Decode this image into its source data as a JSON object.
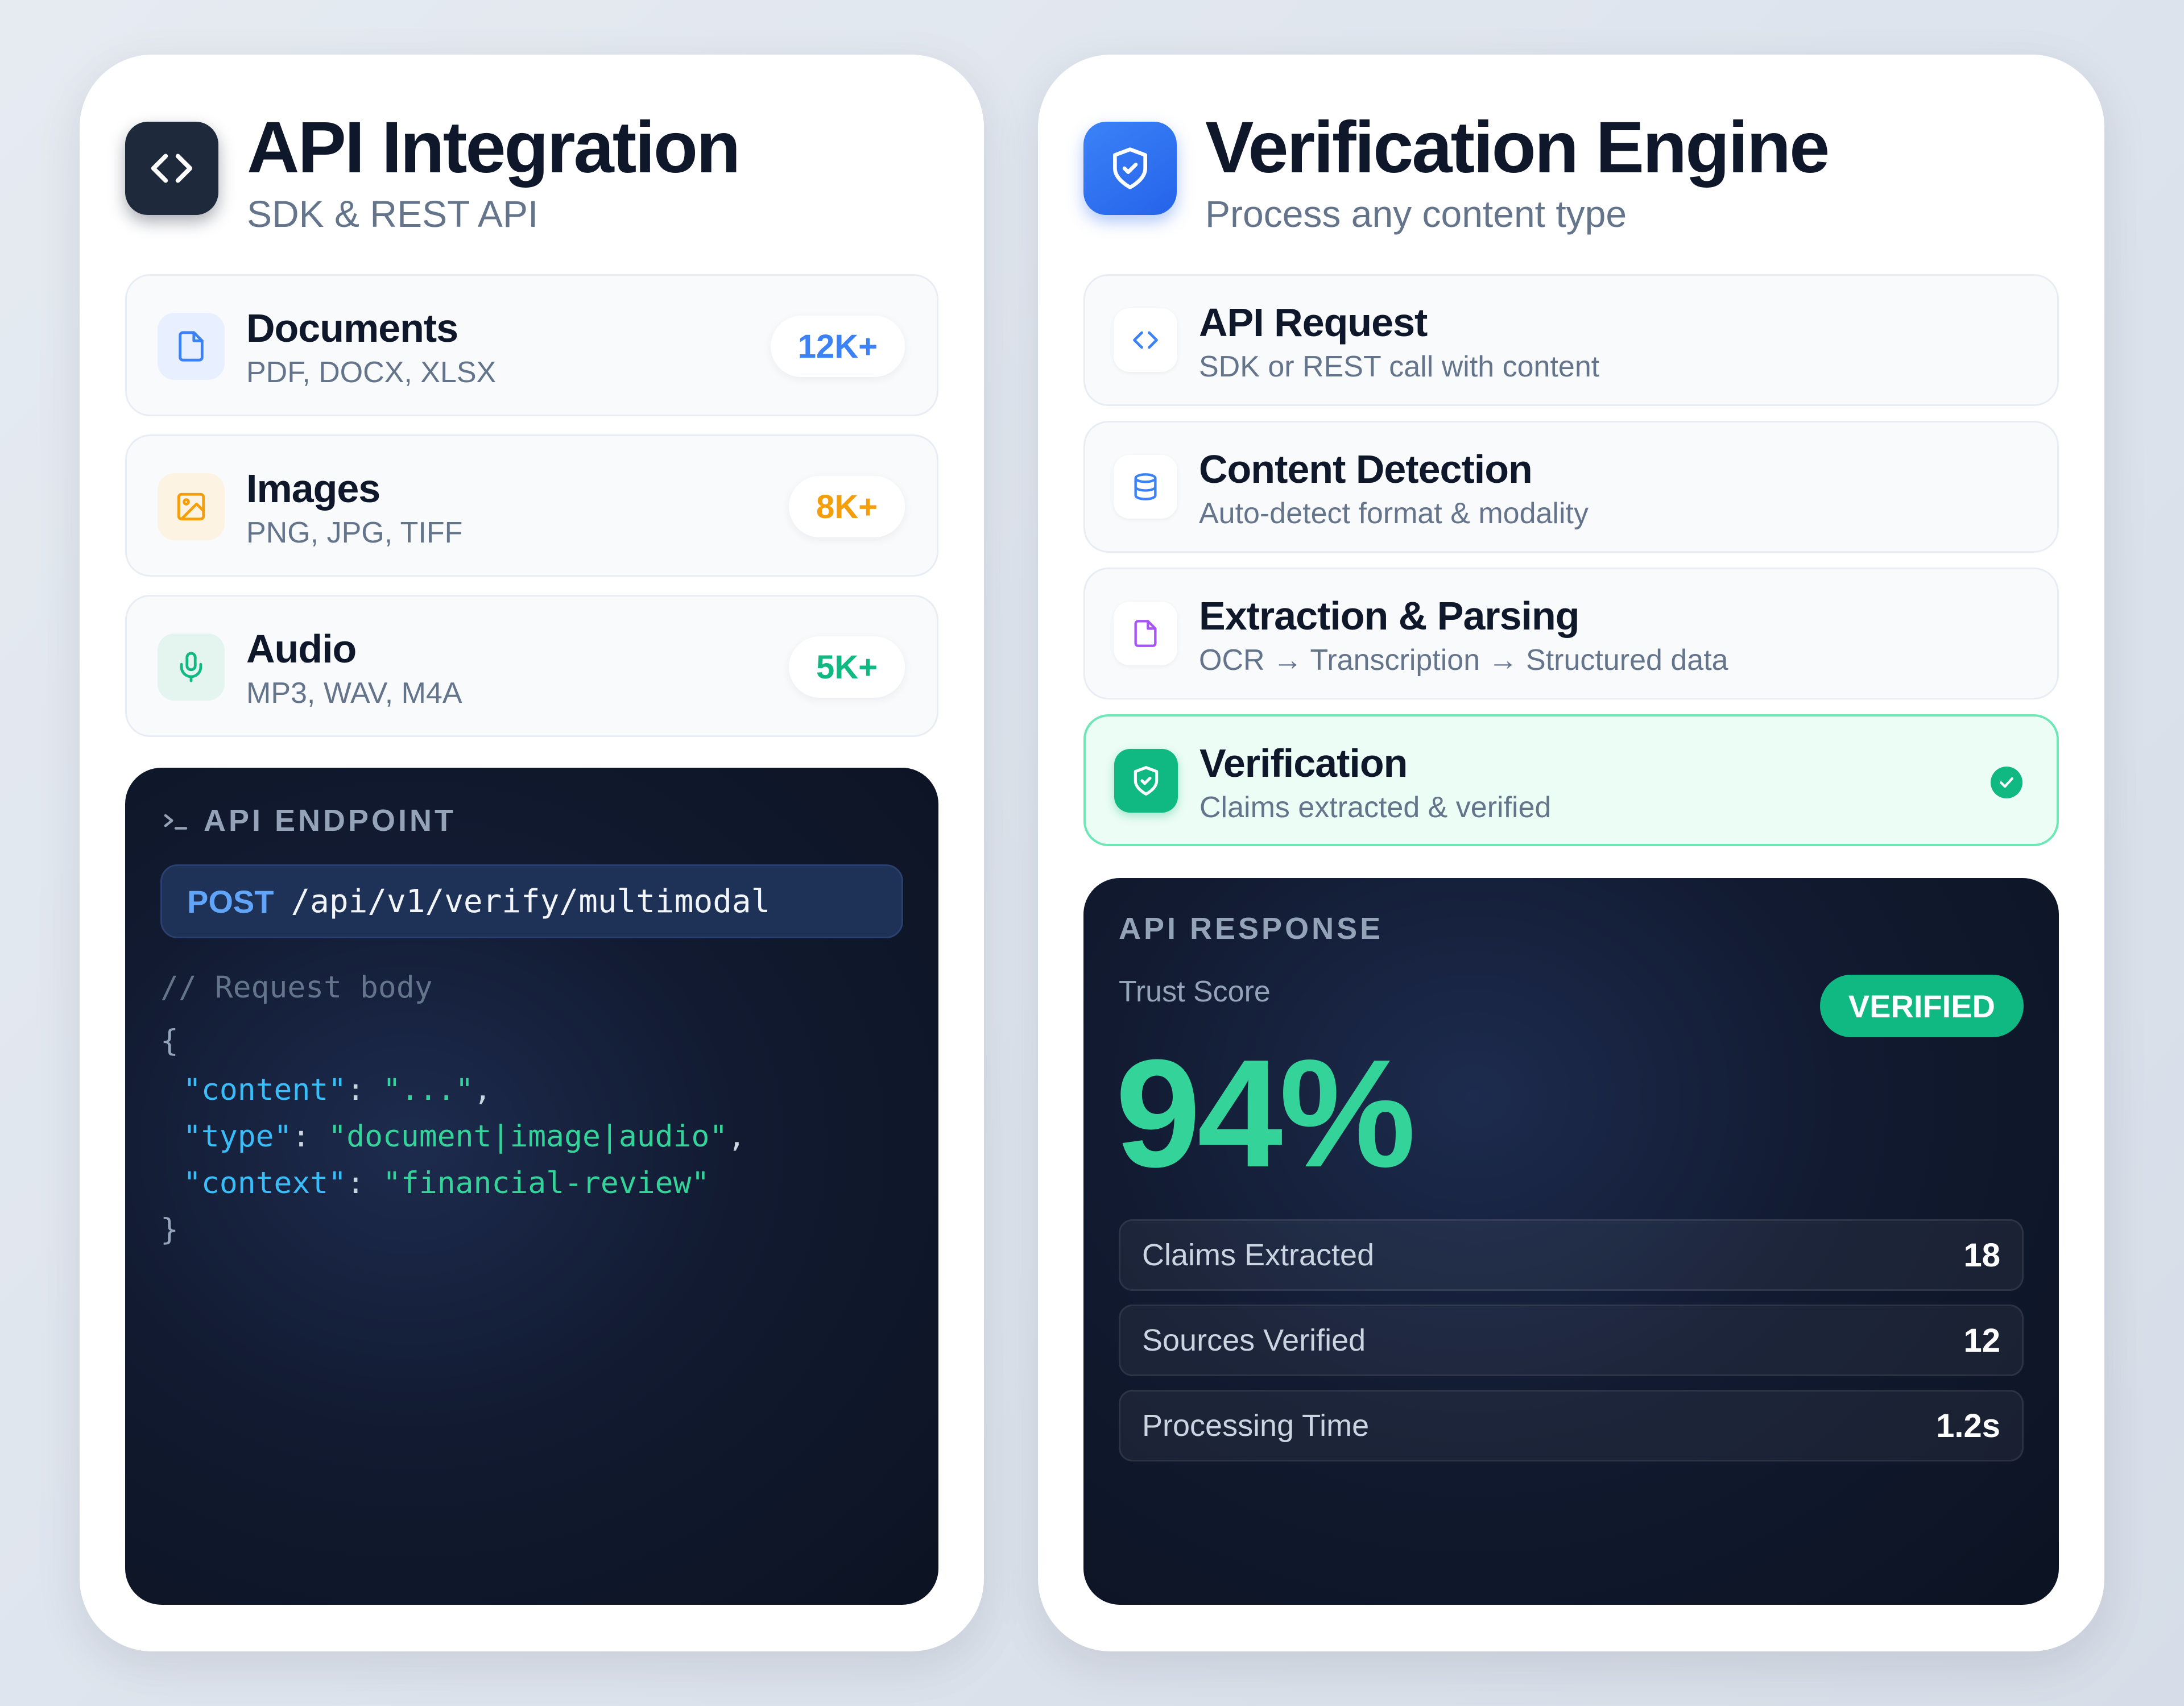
{
  "colors": {
    "background": "#e2e8f0",
    "accent_blue": "#2563eb",
    "accent_green": "#10b981",
    "accent_orange": "#f59e0b",
    "dark_panel": "#0f172a"
  },
  "left": {
    "header": {
      "icon": "code-icon",
      "title": "API Integration",
      "subtitle": "SDK & REST API"
    },
    "file_types": [
      {
        "icon": "document-icon",
        "title": "Documents",
        "formats": "PDF, DOCX, XLSX",
        "count": "12K+",
        "color": "#3b82f6"
      },
      {
        "icon": "image-icon",
        "title": "Images",
        "formats": "PNG, JPG, TIFF",
        "count": "8K+",
        "color": "#f59e0b"
      },
      {
        "icon": "microphone-icon",
        "title": "Audio",
        "formats": "MP3, WAV, M4A",
        "count": "5K+",
        "color": "#10b981"
      }
    ],
    "endpoint": {
      "label": "API ENDPOINT",
      "method": "POST",
      "path": "/api/v1/verify/multimodal",
      "comment": "// Request body",
      "open_brace": "{",
      "close_brace": "}",
      "fields": [
        {
          "key": "\"content\"",
          "value": "\"...\"",
          "trail": ","
        },
        {
          "key": "\"type\"",
          "value": "\"document|image|audio\"",
          "trail": ","
        },
        {
          "key": "\"context\"",
          "value": "\"financial-review\"",
          "trail": ""
        }
      ]
    }
  },
  "right": {
    "header": {
      "icon": "shield-icon",
      "title": "Verification Engine",
      "subtitle": "Process any content type"
    },
    "steps": [
      {
        "icon": "code-icon",
        "title": "API Request",
        "desc": "SDK or REST call with content",
        "active": false
      },
      {
        "icon": "database-icon",
        "title": "Content Detection",
        "desc": "Auto-detect format & modality",
        "active": false
      },
      {
        "icon": "file-icon",
        "title": "Extraction & Parsing",
        "desc": "OCR → Transcription → Structured data",
        "active": false
      },
      {
        "icon": "shield-check-icon",
        "title": "Verification",
        "desc": "Claims extracted & verified",
        "active": true
      }
    ],
    "response": {
      "label": "API RESPONSE",
      "trust_label": "Trust Score",
      "status": "VERIFIED",
      "score": "94%",
      "metrics": [
        {
          "label": "Claims Extracted",
          "value": "18"
        },
        {
          "label": "Sources Verified",
          "value": "12"
        },
        {
          "label": "Processing Time",
          "value": "1.2s"
        }
      ]
    }
  }
}
